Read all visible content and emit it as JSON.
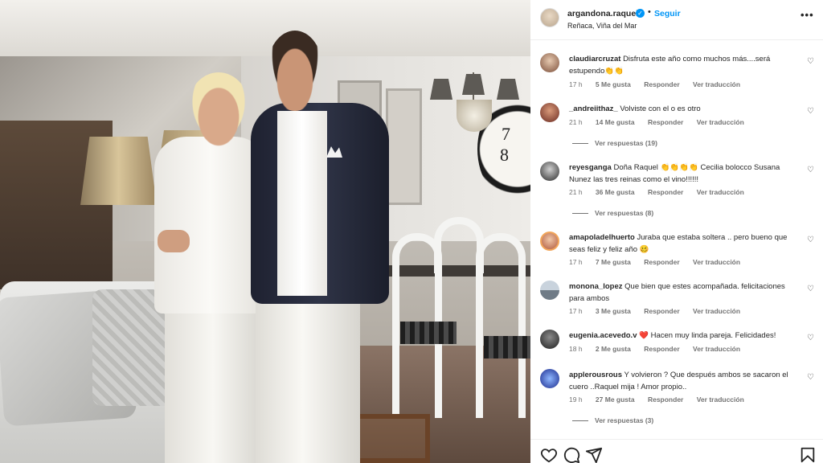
{
  "post": {
    "username": "argandona.raquel",
    "follow_label": "Seguir",
    "location": "Reñaca, Viña del Mar",
    "verified": true
  },
  "photo": {
    "clock_numbers": [
      "8",
      "7"
    ]
  },
  "comments": [
    {
      "user": "claudiarcruzat",
      "text": "Disfruta este año como muchos más....será estupendo👏👏",
      "time": "17 h",
      "likes": "5 Me gusta",
      "reply": "Responder",
      "translate": "Ver traducción",
      "replies": ""
    },
    {
      "user": "_andreiithaz_",
      "text": "Volviste con el o es otro",
      "time": "21 h",
      "likes": "14 Me gusta",
      "reply": "Responder",
      "translate": "Ver traducción",
      "replies": "Ver respuestas (19)"
    },
    {
      "user": "reyesganga",
      "text": "Doña Raquel 👏👏👏👏 Cecilia bolocco Susana Nunez las tres reinas como el vino!!!!!!",
      "time": "21 h",
      "likes": "36 Me gusta",
      "reply": "Responder",
      "translate": "Ver traducción",
      "replies": "Ver respuestas (8)"
    },
    {
      "user": "amapoladelhuerto",
      "text": "Juraba que estaba soltera .. pero bueno que seas feliz y feliz año 🥴",
      "time": "17 h",
      "likes": "7 Me gusta",
      "reply": "Responder",
      "translate": "Ver traducción",
      "replies": ""
    },
    {
      "user": "monona_lopez",
      "text": "Que bien que estes acompañada. felicitaciones para ambos",
      "time": "17 h",
      "likes": "3 Me gusta",
      "reply": "Responder",
      "translate": "Ver traducción",
      "replies": ""
    },
    {
      "user": "eugenia.acevedo.v",
      "text": "❤️ Hacen muy linda pareja. Felicidades!",
      "time": "18 h",
      "likes": "2 Me gusta",
      "reply": "Responder",
      "translate": "Ver traducción",
      "replies": ""
    },
    {
      "user": "applerousrous",
      "text": "Y volvieron ? Que después ambos se sacaron el cuero ..Raquel mija ! Amor propio..",
      "time": "19 h",
      "likes": "27 Me gusta",
      "reply": "Responder",
      "translate": "Ver traducción",
      "replies": "Ver respuestas (3)"
    }
  ],
  "icons": {
    "heart": "heart-icon",
    "comment": "comment-icon",
    "share": "share-icon",
    "save": "bookmark-icon",
    "more": "more-options-icon",
    "verified": "verified-badge-icon"
  },
  "colors": {
    "accent": "#0095f6",
    "text": "#262626",
    "muted": "#737373"
  }
}
